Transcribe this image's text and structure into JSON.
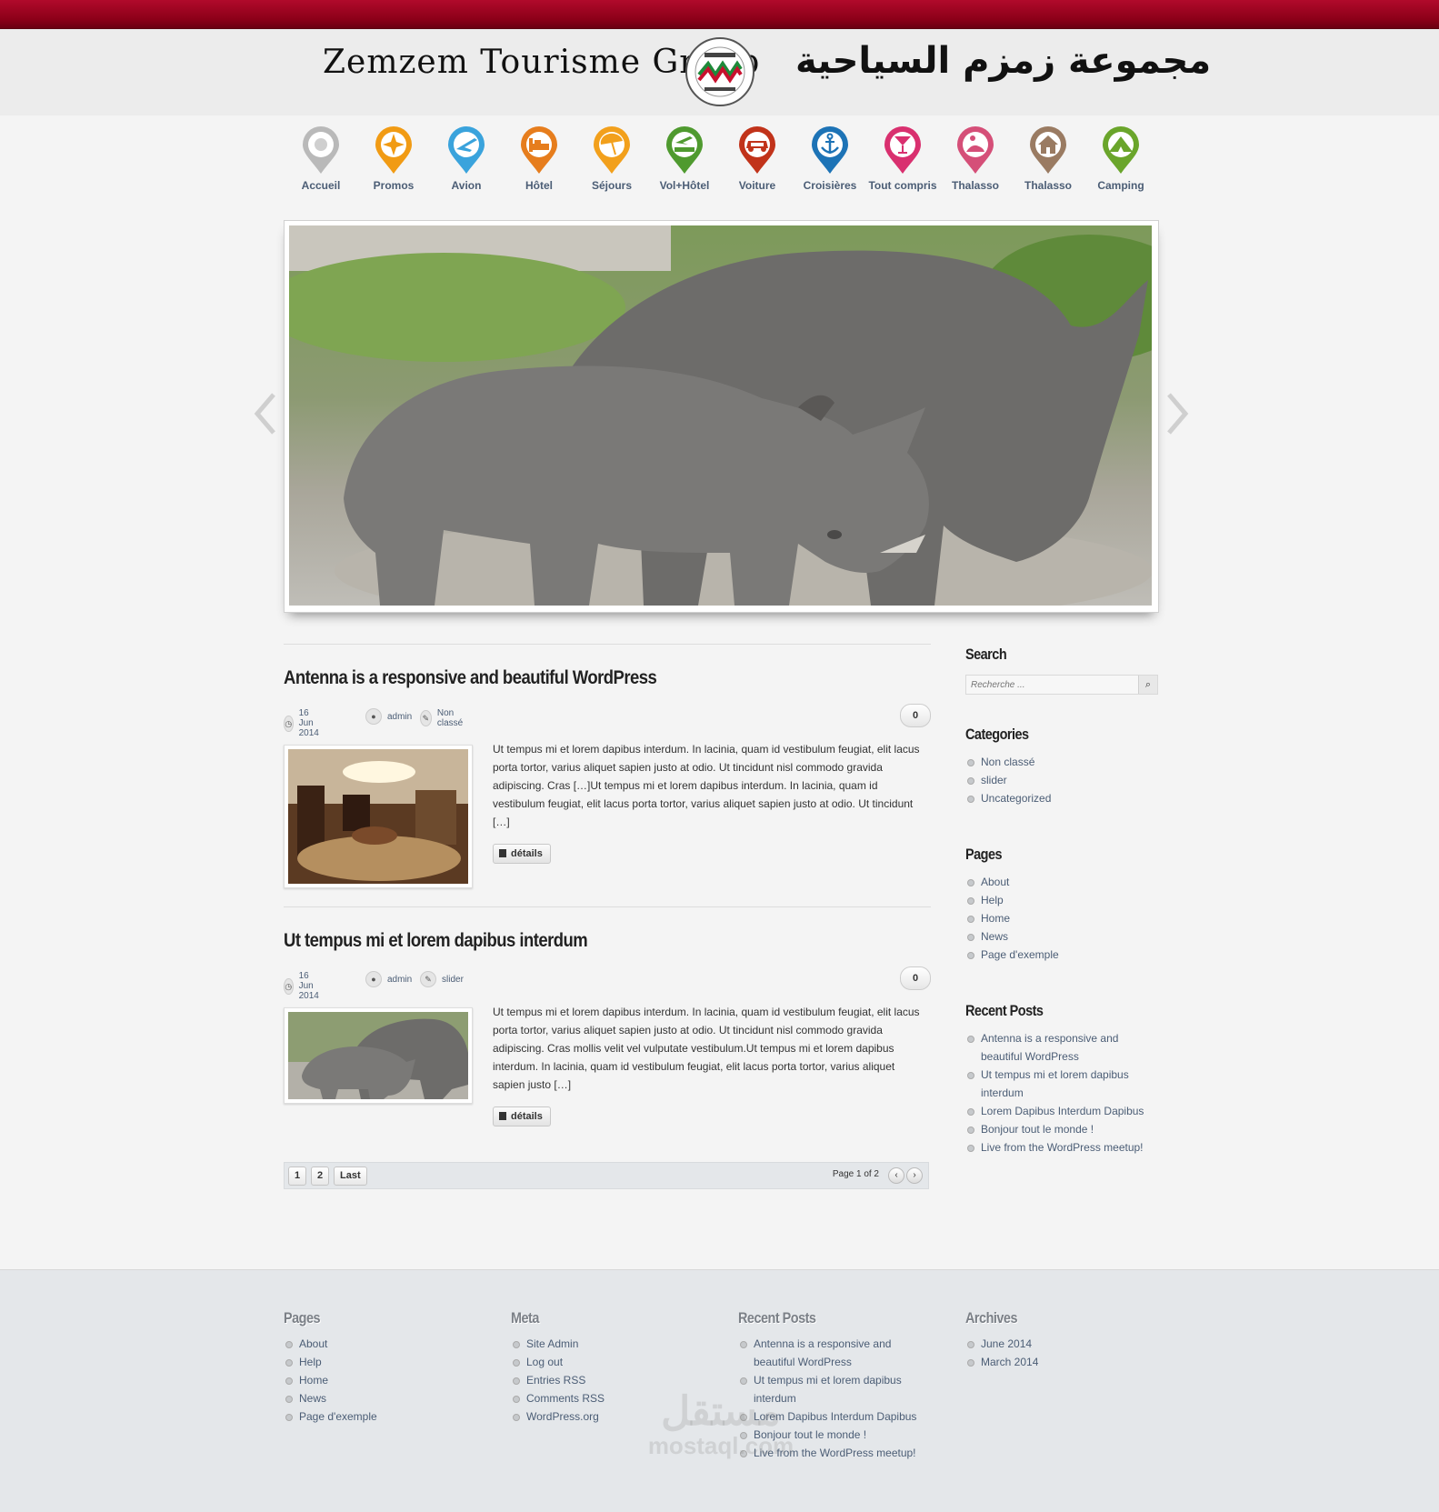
{
  "site": {
    "title_en": "Zemzem Tourisme Group",
    "title_ar": "مجموعة زمزم السياحية",
    "logo_text": "ZEMZEM TOURISM GROUP"
  },
  "nav": [
    {
      "label": "Accueil",
      "icon": "location-pin-icon",
      "color": "#b9b9b9"
    },
    {
      "label": "Promos",
      "icon": "star-icon",
      "color": "#f19b14"
    },
    {
      "label": "Avion",
      "icon": "airplane-icon",
      "color": "#3aa3dc"
    },
    {
      "label": "Hôtel",
      "icon": "bed-icon",
      "color": "#e67d1d"
    },
    {
      "label": "Séjours",
      "icon": "beach-umbrella-icon",
      "color": "#f2a01c"
    },
    {
      "label": "Vol+Hôtel",
      "icon": "plane-bed-icon",
      "color": "#4f9a2f"
    },
    {
      "label": "Voiture",
      "icon": "car-icon",
      "color": "#c1331a"
    },
    {
      "label": "Croisières",
      "icon": "anchor-icon",
      "color": "#1d73b6"
    },
    {
      "label": "Tout compris",
      "icon": "cocktail-icon",
      "color": "#d9306f"
    },
    {
      "label": "Thalasso",
      "icon": "spa-icon",
      "color": "#d54f78"
    },
    {
      "label": "Thalasso",
      "icon": "house-icon",
      "color": "#9a7b62"
    },
    {
      "label": "Camping",
      "icon": "tent-icon",
      "color": "#6aa52b"
    }
  ],
  "slider": {
    "image": "rhinoceros-photo",
    "prev_icon": "chevron-left-icon",
    "next_icon": "chevron-right-icon"
  },
  "posts": [
    {
      "title": "Antenna is a responsive and beautiful WordPress",
      "date": "16 Jun 2014",
      "author": "admin",
      "category": "Non classé",
      "comments": "0",
      "thumb": "hotel-lobby-photo",
      "excerpt": "Ut tempus mi et lorem dapibus interdum. In lacinia, quam id vestibulum feugiat, elit lacus porta tortor, varius aliquet sapien justo at odio. Ut tincidunt nisl commodo gravida adipiscing. Cras […]Ut tempus mi et lorem dapibus interdum. In lacinia, quam id vestibulum feugiat, elit lacus porta tortor, varius aliquet sapien justo at odio. Ut tincidunt […]",
      "more": "détails"
    },
    {
      "title": "Ut tempus mi et lorem dapibus interdum",
      "date": "16 Jun 2014",
      "author": "admin",
      "category": "slider",
      "comments": "0",
      "thumb": "rhinoceros-photo",
      "excerpt": "Ut tempus mi et lorem dapibus interdum. In lacinia, quam id vestibulum feugiat, elit lacus porta tortor, varius aliquet sapien justo at odio. Ut tincidunt nisl commodo gravida adipiscing. Cras mollis velit vel vulputate vestibulum.Ut tempus mi et lorem dapibus interdum. In lacinia, quam id vestibulum feugiat, elit lacus porta tortor, varius aliquet sapien justo […]",
      "more": "détails"
    }
  ],
  "pagination": {
    "pages": [
      "1",
      "2"
    ],
    "last": "Last",
    "info": "Page 1 of 2",
    "prev": "‹",
    "next": "›"
  },
  "sidebar": {
    "search_title": "Search",
    "search_placeholder": "Recherche ...",
    "categories_title": "Categories",
    "categories": [
      "Non classé",
      "slider",
      "Uncategorized"
    ],
    "pages_title": "Pages",
    "pages": [
      "About",
      "Help",
      "Home",
      "News",
      "Page d'exemple"
    ],
    "recent_title": "Recent Posts",
    "recent": [
      "Antenna is a responsive and beautiful WordPress",
      "Ut tempus mi et lorem dapibus interdum",
      "Lorem Dapibus Interdum Dapibus",
      "Bonjour tout le monde !",
      "Live from the WordPress meetup!"
    ]
  },
  "footer": {
    "pages_title": "Pages",
    "pages": [
      "About",
      "Help",
      "Home",
      "News",
      "Page d'exemple"
    ],
    "meta_title": "Meta",
    "meta": [
      "Site Admin",
      "Log out",
      "Entries RSS",
      "Comments RSS",
      "WordPress.org"
    ],
    "recent_title": "Recent Posts",
    "recent": [
      "Antenna is a responsive and beautiful WordPress",
      "Ut tempus mi et lorem dapibus interdum",
      "Lorem Dapibus Interdum Dapibus",
      "Bonjour tout le monde !",
      "Live from the WordPress meetup!"
    ],
    "archives_title": "Archives",
    "archives": [
      "June 2014",
      "March 2014"
    ]
  },
  "watermark": {
    "arabic": "مستقل",
    "latin": "mostaql.com"
  },
  "colors": {
    "topbar": "#a0001f",
    "link": "#4b5d75",
    "background": "#f4f4f4",
    "footer": "#e4e7ea"
  }
}
